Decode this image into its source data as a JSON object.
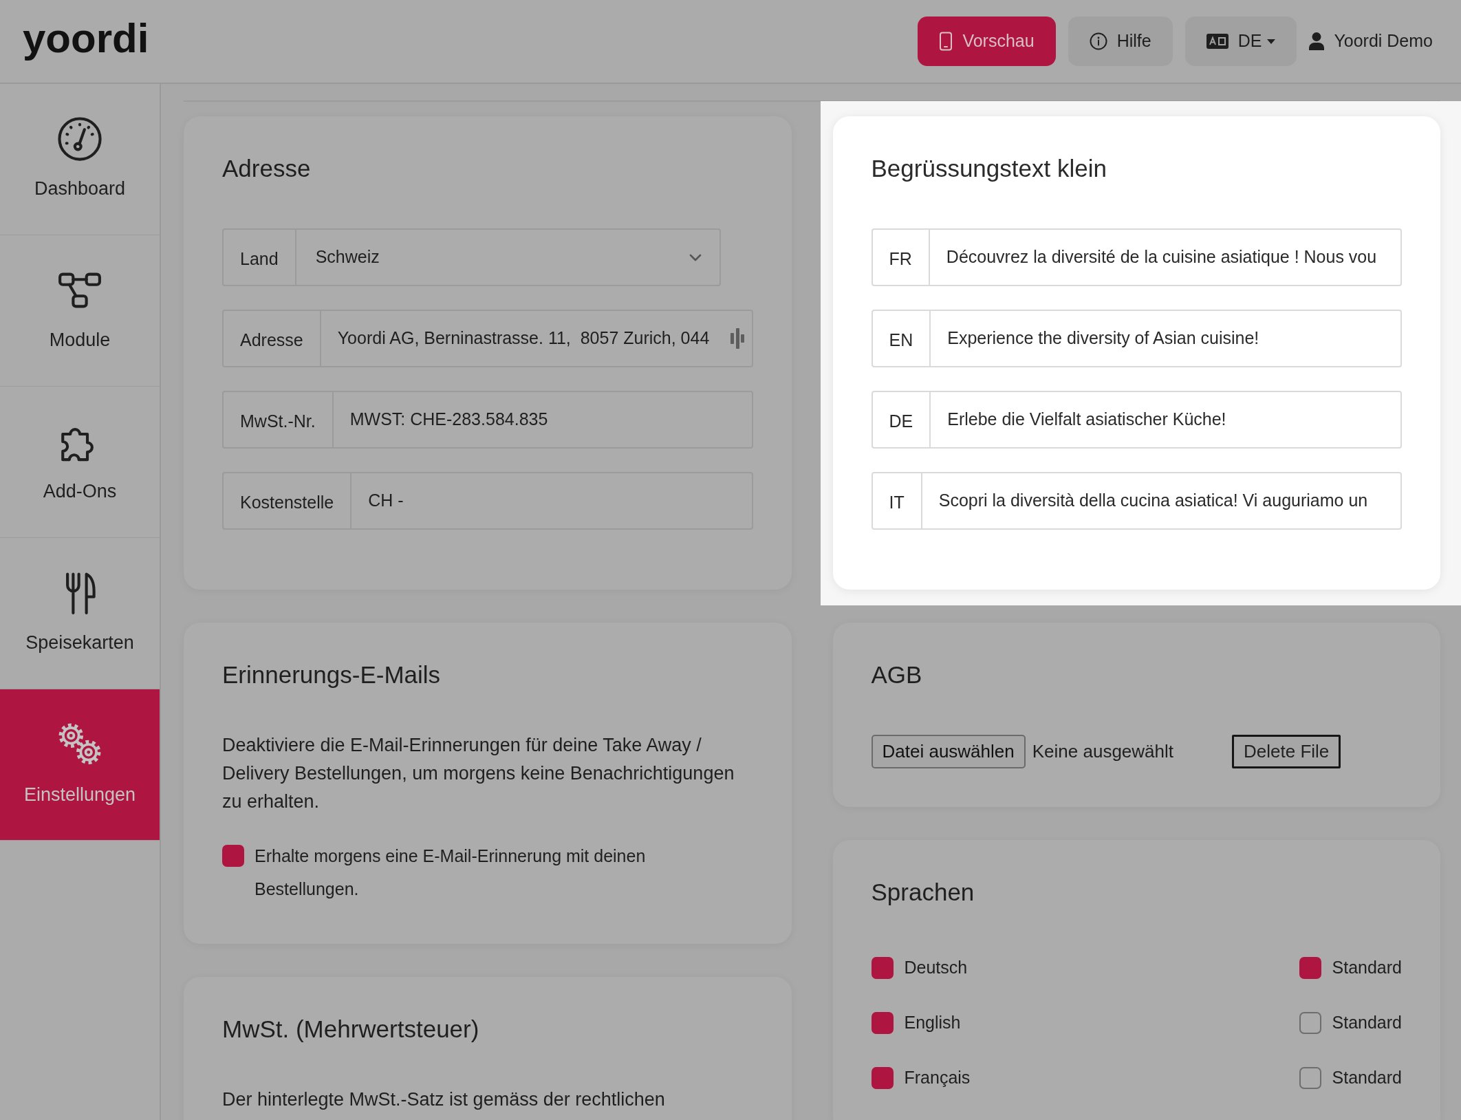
{
  "header": {
    "logo": "yoordi",
    "actions": [
      {
        "kind": "preview",
        "label": "Vorschau"
      },
      {
        "kind": "help",
        "label": "Hilfe"
      },
      {
        "kind": "language",
        "label": "DE"
      },
      {
        "kind": "account",
        "label": "Yoordi Demo"
      }
    ]
  },
  "sidebar": {
    "items": [
      {
        "label": "Dashboard",
        "selected": false
      },
      {
        "label": "Module",
        "selected": false
      },
      {
        "label": "Add-Ons",
        "selected": false
      },
      {
        "label": "Speisekarten",
        "selected": false
      },
      {
        "label": "Einstellungen",
        "selected": true
      }
    ]
  },
  "columns": [
    {
      "cards": [
        {
          "kind": "fields",
          "title": "Adresse",
          "highlighted": false,
          "fields": [
            {
              "kind": "select",
              "label": "Land",
              "value": "Schweiz"
            },
            {
              "kind": "autofill",
              "label": "Adresse",
              "value": "Yoordi AG, Berninastrasse. 11,  8057 Zurich, 044"
            },
            {
              "kind": "text",
              "label": "MwSt.-Nr.",
              "value": "MWST: CHE-283.584.835"
            },
            {
              "kind": "text",
              "label": "Kostenstelle",
              "value": "CH -"
            }
          ]
        },
        {
          "kind": "reminder",
          "title": "Erinnerungs-E-Mails",
          "highlighted": false,
          "description": "Deaktiviere die E-Mail-Erinnerungen für deine Take Away / Delivery Bestellungen, um morgens keine Benachrichtigungen zu erhalten.",
          "checkbox": {
            "label": "Erhalte morgens eine E-Mail-Erinnerung mit deinen Bestellungen.",
            "checked": true
          }
        },
        {
          "kind": "note",
          "title": "MwSt. (Mehrwertsteuer)",
          "highlighted": false,
          "description": "Der hinterlegte MwSt.-Satz ist gemäss der rechtlichen"
        }
      ]
    },
    {
      "cards": [
        {
          "kind": "fields",
          "title": "Begrüssungstext klein",
          "highlighted": true,
          "fields": [
            {
              "kind": "text",
              "label": "FR",
              "value": "Découvrez la diversité de la cuisine asiatique ! Nous vou"
            },
            {
              "kind": "text",
              "label": "EN",
              "value": "Experience the diversity of Asian cuisine!"
            },
            {
              "kind": "text",
              "label": "DE",
              "value": "Erlebe die Vielfalt asiatischer Küche!"
            },
            {
              "kind": "text",
              "label": "IT",
              "value": "Scopri la diversità della cucina asiatica! Vi auguriamo un"
            }
          ]
        },
        {
          "kind": "file",
          "title": "AGB",
          "highlighted": false,
          "choose_button": "Datei auswählen",
          "file_status": "Keine ausgewählt",
          "delete_button": "Delete File"
        },
        {
          "kind": "languages",
          "title": "Sprachen",
          "highlighted": false,
          "rows": [
            {
              "label": "Deutsch",
              "checked": true,
              "standard": {
                "label": "Standard",
                "checked": true
              }
            },
            {
              "label": "English",
              "checked": true,
              "standard": {
                "label": "Standard",
                "checked": false
              }
            },
            {
              "label": "Français",
              "checked": true,
              "standard": {
                "label": "Standard",
                "checked": false
              }
            }
          ]
        }
      ]
    }
  ]
}
